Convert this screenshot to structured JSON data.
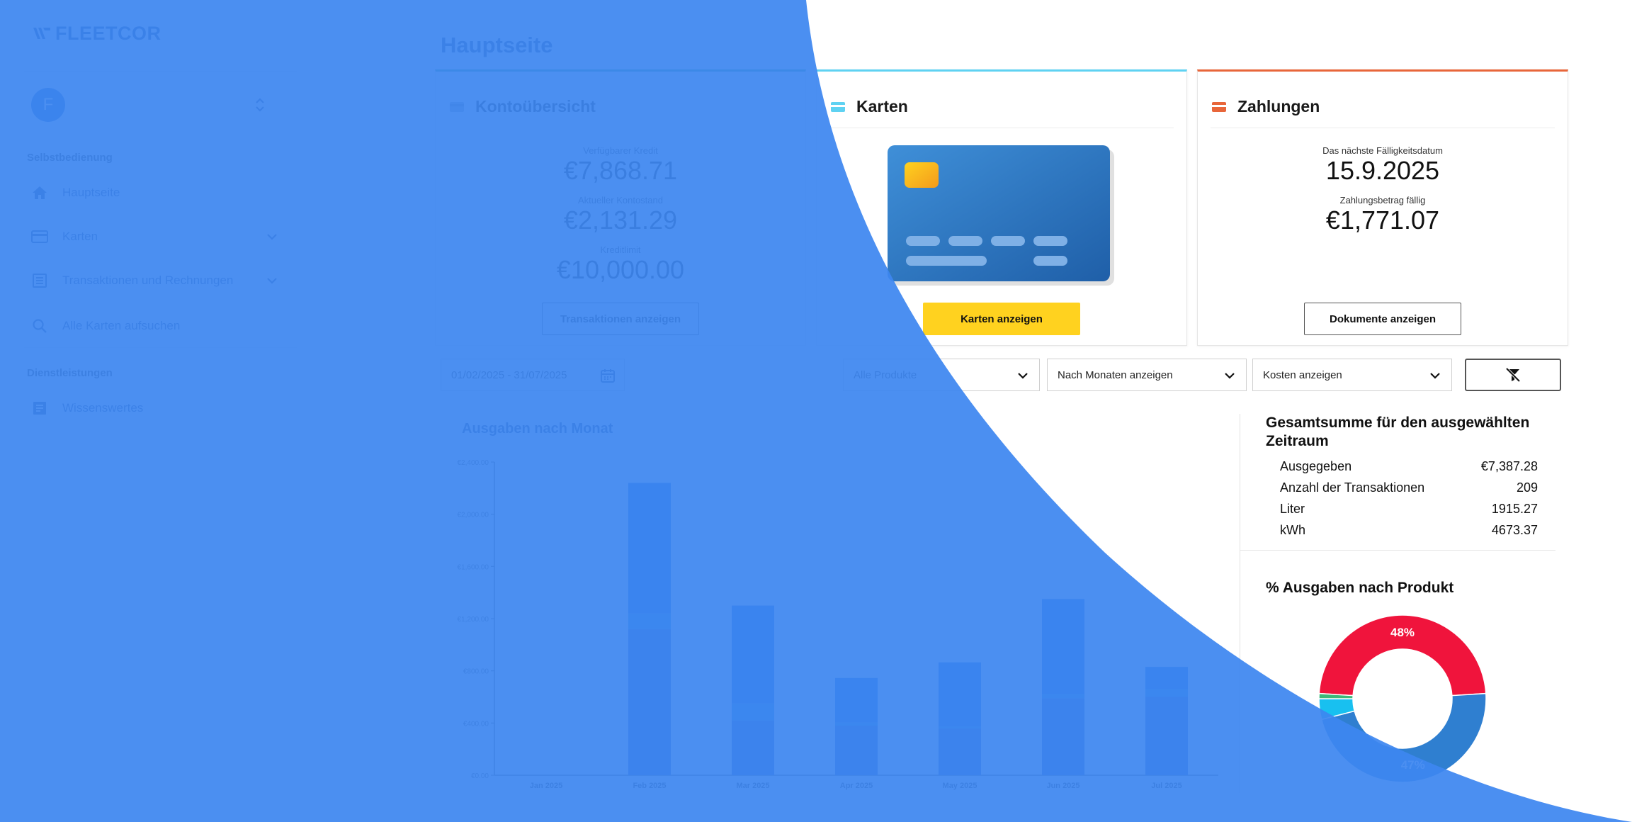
{
  "logo": {
    "text": "FLEETCOR"
  },
  "account": {
    "initial": "F"
  },
  "sidebar": {
    "section_self_service": "Selbstbedienung",
    "items": [
      {
        "label": "Hauptseite"
      },
      {
        "label": "Karten"
      },
      {
        "label": "Transaktionen und Rechnungen"
      },
      {
        "label": "Alle Karten aufsuchen"
      }
    ],
    "section_services": "Dienstleistungen",
    "services_items": [
      {
        "label": "Wissenswertes"
      }
    ]
  },
  "page": {
    "title": "Hauptseite"
  },
  "account_overview": {
    "title": "Kontoübersicht",
    "available_credit_label": "Verfügbarer Kredit",
    "available_credit": "€7,868.71",
    "balance_label": "Aktueller Kontostand",
    "balance": "€2,131.29",
    "credit_limit_label": "Kreditlimit",
    "credit_limit": "€10,000.00",
    "button": "Transaktionen anzeigen"
  },
  "cards_panel": {
    "title": "Karten",
    "button": "Karten anzeigen"
  },
  "payments_panel": {
    "title": "Zahlungen",
    "due_date_label": "Das nächste Fälligkeitsdatum",
    "due_date": "15.9.2025",
    "amount_label": "Zahlungsbetrag fällig",
    "amount": "€1,771.07",
    "button": "Dokumente anzeigen"
  },
  "filters": {
    "date_range": "01/02/2025 - 31/07/2025",
    "products": "Alle Produkte",
    "grouping": "Nach Monaten anzeigen",
    "measure": "Kosten anzeigen"
  },
  "chart_data": {
    "type": "bar",
    "title": "Ausgaben nach Monat",
    "categories": [
      "Jan 2025",
      "Feb 2025",
      "Mar 2025",
      "Apr 2025",
      "May 2025",
      "Jun 2025",
      "Jul 2025"
    ],
    "ytick_labels": [
      "€0.00",
      "€400.00",
      "€800.00",
      "€1,200.00",
      "€1,600.00",
      "€2,000.00",
      "€2,400.00"
    ],
    "ylim": [
      0,
      2400
    ],
    "stacked": true,
    "series": [
      {
        "color": "#3553c4",
        "values": [
          0,
          1120,
          420,
          380,
          360,
          590,
          600
        ]
      },
      {
        "color": "#1c8de0",
        "values": [
          0,
          120,
          130,
          25,
          15,
          30,
          60
        ]
      },
      {
        "color": "#1466d8",
        "values": [
          0,
          1000,
          750,
          340,
          490,
          730,
          170
        ]
      }
    ],
    "grid": false,
    "legend": "none"
  },
  "summary": {
    "title": "Gesamtsumme für den ausgewählten Zeitraum",
    "rows": [
      {
        "label": "Ausgegeben",
        "value": "€7,387.28"
      },
      {
        "label": "Anzahl der Transaktionen",
        "value": "209"
      },
      {
        "label": "Liter",
        "value": "1915.27"
      },
      {
        "label": "kWh",
        "value": "4673.37"
      }
    ]
  },
  "pie": {
    "title": "% Ausgaben nach Produkt",
    "type": "pie",
    "donut": true,
    "slices": [
      {
        "value": 48,
        "label": "48%",
        "color": "#f0143c"
      },
      {
        "value": 47,
        "label": "47%",
        "color": "#2f7fd0"
      },
      {
        "value": 4,
        "label": "",
        "color": "#18c0f0"
      },
      {
        "value": 1,
        "label": "",
        "color": "#3cb878"
      }
    ]
  },
  "colors": {
    "overlay_blue": "#3d86f0",
    "brand_navy": "#1e3c78",
    "card_accent_cyan": "#5fd2f2",
    "card_accent_orange": "#e8663a",
    "button_yellow": "#ffd21f"
  }
}
